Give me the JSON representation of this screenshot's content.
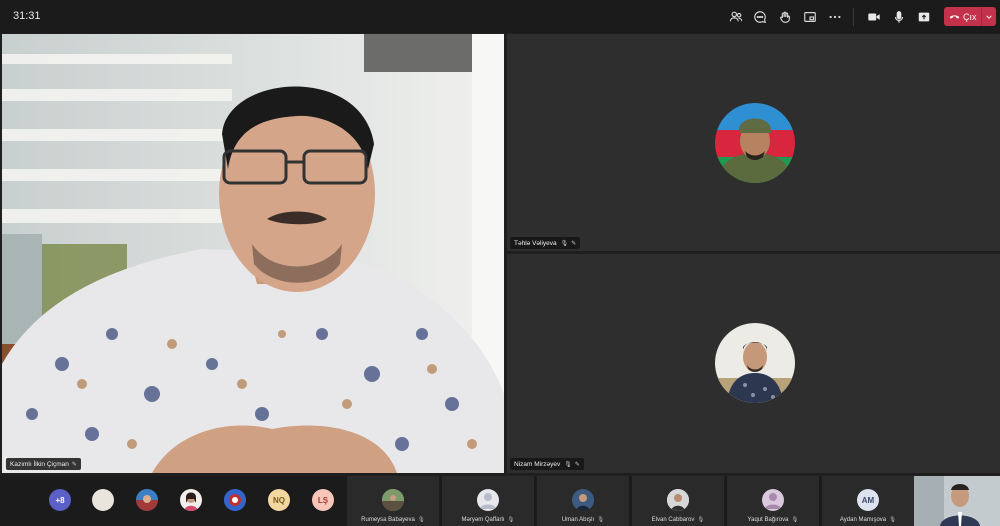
{
  "toolbar": {
    "timer": "31:31",
    "leave_label": "Çıx"
  },
  "tiles": {
    "main": {
      "name": "Kazımlı İlkin Çiçman"
    },
    "right_top": {
      "name": "Təhlə Vəliyeva"
    },
    "right_bottom": {
      "name": "Nizam Mirzəyev"
    }
  },
  "bottom_strip": {
    "overflow_count": "+8",
    "initials_1": "NQ",
    "initials_2": "LŞ",
    "participants": [
      {
        "name": "Rumeysa Babayeva"
      },
      {
        "name": "Məryəm Qaffarlı"
      },
      {
        "name": "Uman Abışlı"
      },
      {
        "name": "Elvan Cabbarov"
      },
      {
        "name": "Yaqut Bağırova"
      },
      {
        "name": "Aydan Mamışova",
        "initials": "AM"
      }
    ]
  },
  "colors": {
    "leave": "#c4314b",
    "overflow_badge": "#5b5fc7",
    "nq_badge": "#f2d7a1",
    "ls_badge": "#f7c6b8",
    "am_badge": "#dce3ef"
  }
}
